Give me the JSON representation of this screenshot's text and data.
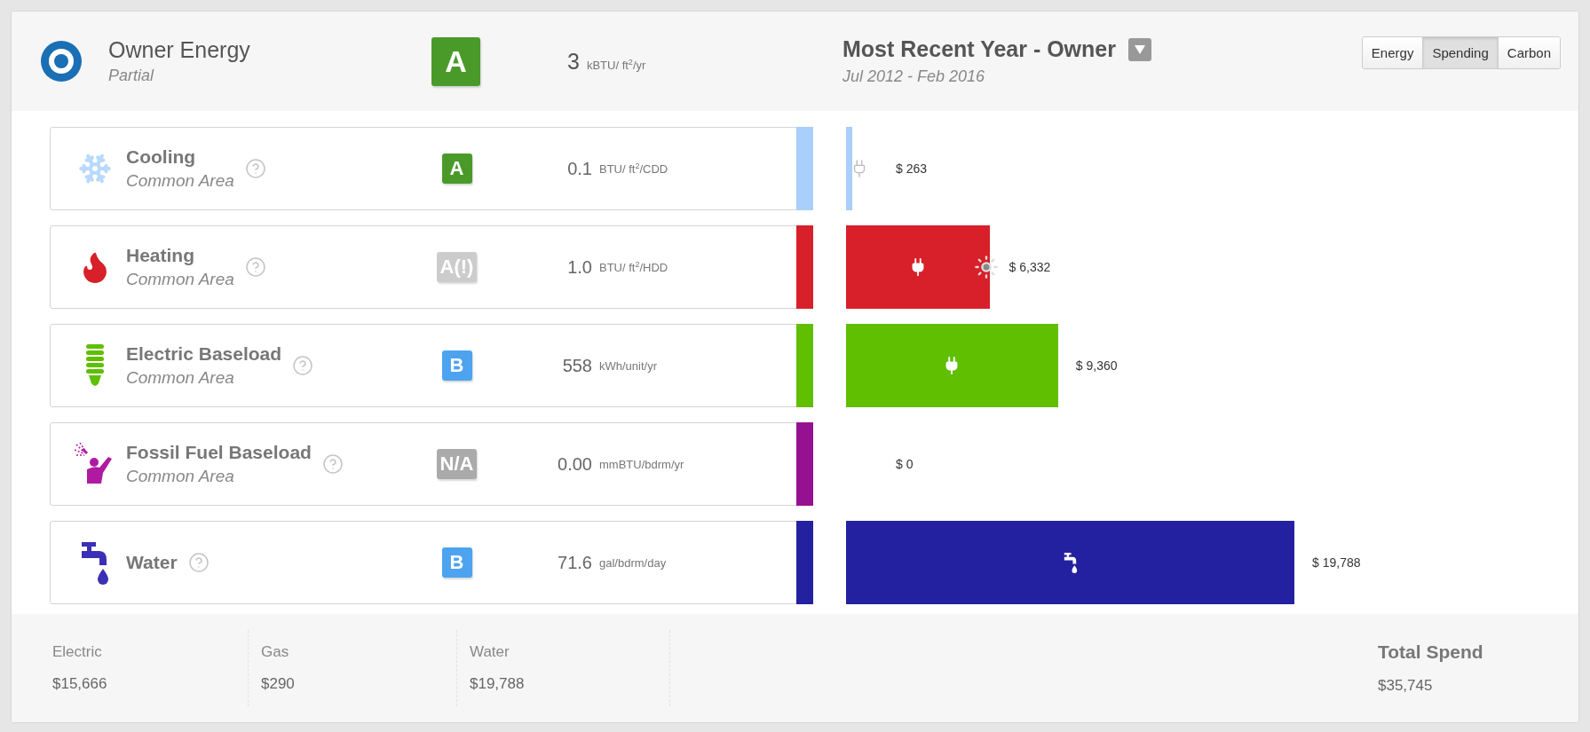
{
  "header": {
    "title": "Owner Energy",
    "subtitle": "Partial",
    "grade": {
      "label": "A",
      "color": "#4a9a2a"
    },
    "value": "3",
    "unit": "kBTU/ ft$^{2}$/yr",
    "period_title": "Most Recent Year - Owner",
    "period": "Jul 2012 - Feb 2016"
  },
  "view_tabs": [
    {
      "label": "Energy",
      "selected": false
    },
    {
      "label": "Spending",
      "selected": true
    },
    {
      "label": "Carbon",
      "selected": false
    }
  ],
  "rows": [
    {
      "kind": "cooling",
      "name": "Cooling",
      "area": "Common Area",
      "grade": {
        "label": "A",
        "color": "#4a9a2a"
      },
      "value": "0.1",
      "unit": "BTU/ ft$^{2}$/CDD",
      "color": "#a9cffa",
      "spend": "$ 263"
    },
    {
      "kind": "heating",
      "name": "Heating",
      "area": "Common Area",
      "grade": {
        "label": "A(!)",
        "color": "#cccccc"
      },
      "value": "1.0",
      "unit": "BTU/ ft$^{2}$/HDD",
      "color": "#d8202a",
      "spend": "$ 6,332"
    },
    {
      "kind": "electric",
      "name": "Electric Baseload",
      "area": "Common Area",
      "grade": {
        "label": "B",
        "color": "#4da3f0"
      },
      "value": "558",
      "unit": "kWh/unit/yr",
      "color": "#5fbf00",
      "spend": "$ 9,360"
    },
    {
      "kind": "fossil",
      "name": "Fossil Fuel Baseload",
      "area": "Common Area",
      "grade": {
        "label": "N/A",
        "color": "#aaaaaa"
      },
      "value": "0.00",
      "unit": "mmBTU/bdrm/yr",
      "color": "#961092",
      "spend": "$ 0"
    },
    {
      "kind": "water",
      "name": "Water",
      "grade": {
        "label": "B",
        "color": "#4da3f0"
      },
      "value": "71.6",
      "unit": "gal/bdrm/day",
      "color": "#2321a0",
      "spend": "$ 19,788"
    }
  ],
  "footer": {
    "items": [
      {
        "label": "Electric",
        "value": "$15,666"
      },
      {
        "label": "Gas",
        "value": "$290"
      },
      {
        "label": "Water",
        "value": "$19,788"
      }
    ],
    "total": {
      "label": "Total Spend",
      "value": "$35,745"
    }
  }
}
